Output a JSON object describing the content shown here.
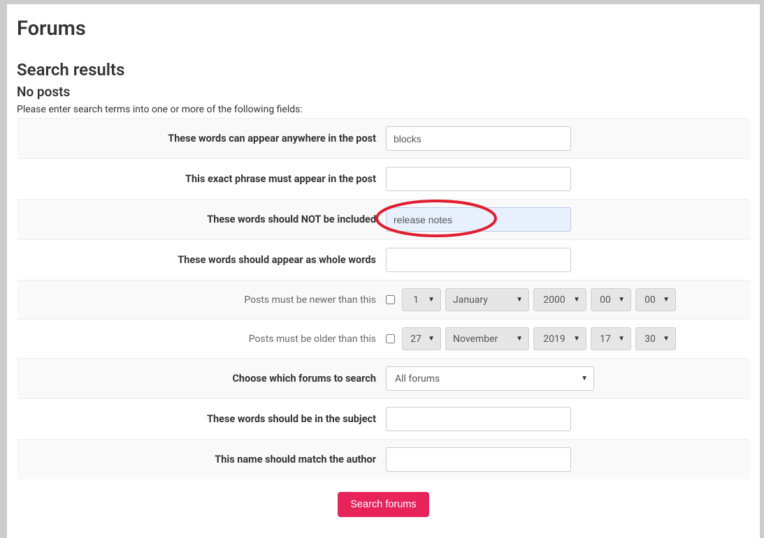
{
  "page": {
    "title": "Forums",
    "section_title": "Search results",
    "result_status": "No posts",
    "hint": "Please enter search terms into one or more of the following fields:"
  },
  "labels": {
    "anywhere": "These words can appear anywhere in the post",
    "exact": "This exact phrase must appear in the post",
    "not_included": "These words should NOT be included",
    "whole_words": "These words should appear as whole words",
    "newer_than": "Posts must be newer than this",
    "older_than": "Posts must be older than this",
    "choose_forums": "Choose which forums to search",
    "subject": "These words should be in the subject",
    "author": "This name should match the author"
  },
  "values": {
    "anywhere": "blocks",
    "exact": "",
    "not_included": "release notes",
    "whole_words": "",
    "newer": {
      "day": "1",
      "month": "January",
      "year": "2000",
      "hour": "00",
      "minute": "00",
      "enabled": false
    },
    "older": {
      "day": "27",
      "month": "November",
      "year": "2019",
      "hour": "17",
      "minute": "30",
      "enabled": false
    },
    "forum": "All forums",
    "subject": "",
    "author": ""
  },
  "submit_label": "Search forums"
}
